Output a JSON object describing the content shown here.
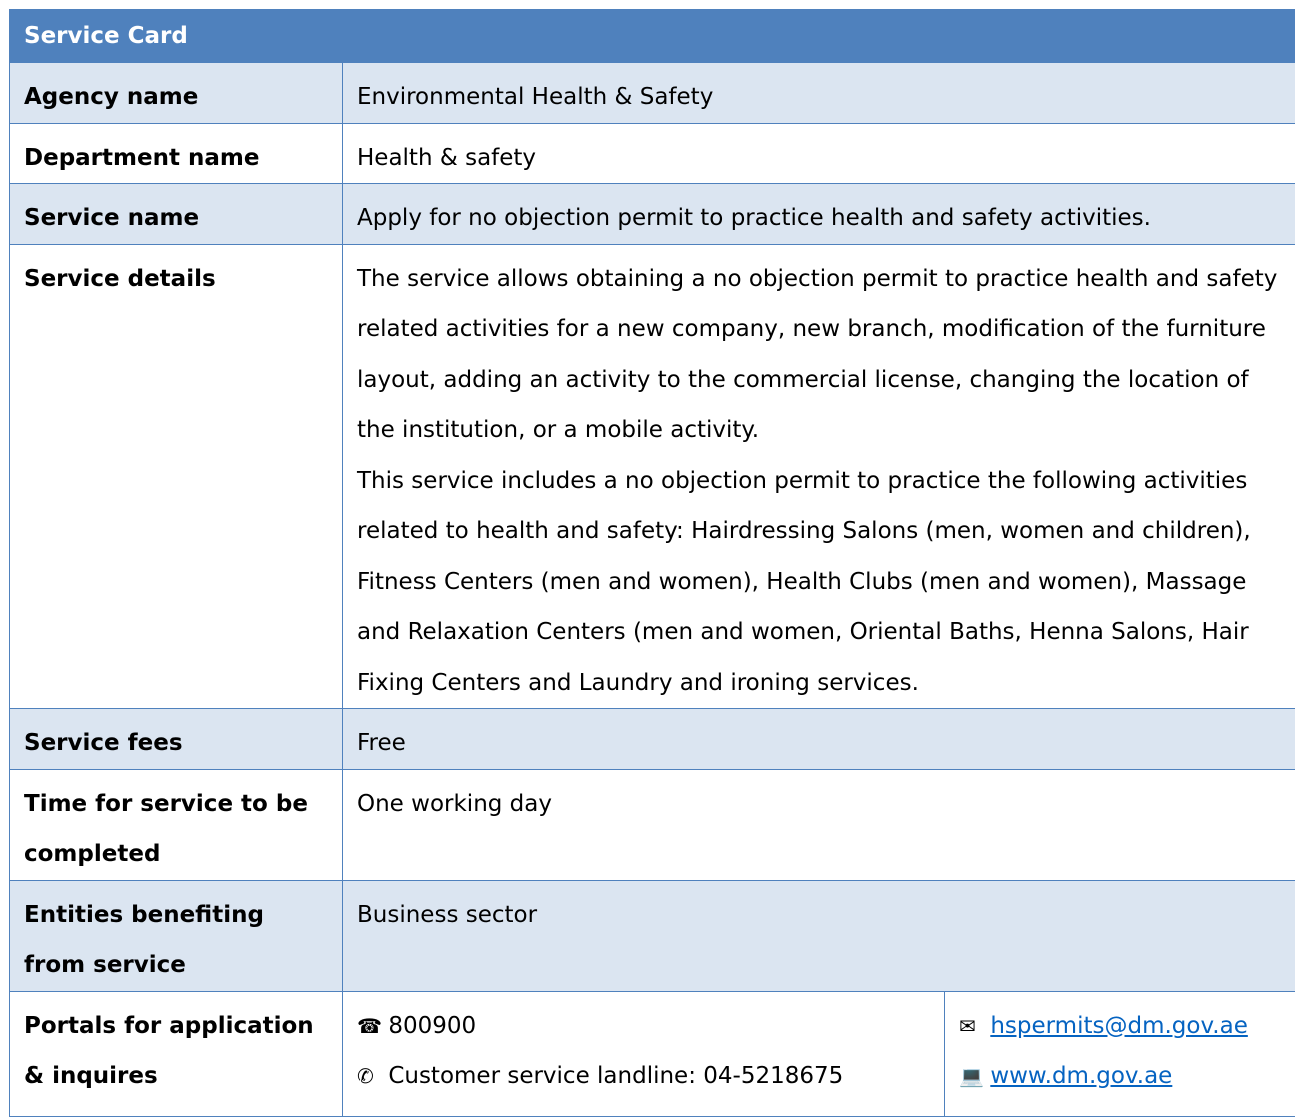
{
  "card": {
    "title": "Service Card",
    "rows": [
      {
        "label": "Agency name",
        "value": "Environmental Health & Safety"
      },
      {
        "label": "Department name",
        "value": "Health & safety"
      },
      {
        "label": "Service name",
        "value": "Apply for no objection permit to practice health and safety activities."
      },
      {
        "label": "Service details",
        "paragraph_1": "The service allows obtaining a no objection permit to practice health and safety related activities for a new company, new branch, modification of the furniture layout, adding an activity to the commercial license, changing the location of the institution, or a mobile activity.",
        "paragraph_2": "This service includes a no objection permit to practice the following activities related to health and safety: Hairdressing Salons (men, women and children), Fitness Centers (men and women), Health Clubs (men and women), Massage and Relaxation Centers (men and women, Oriental Baths, Henna Salons, Hair Fixing Centers and Laundry and ironing services."
      },
      {
        "label": "Service fees",
        "value": "Free"
      },
      {
        "label": "Time for service to be completed",
        "value": "One working day"
      },
      {
        "label": "Entities benefiting from service",
        "value": "Business sector"
      },
      {
        "label": "Portals for application & inquires",
        "phone_icon": "☎",
        "phone": "800900",
        "mobile_icon": "✆",
        "landline": "Customer service landline: 04-5218675",
        "email_icon": "✉",
        "email": "hspermits@dm.gov.ae",
        "web_icon": "💻",
        "website": "www.dm.gov.ae"
      }
    ]
  },
  "colors": {
    "header_bg": "#4f81bd",
    "shade_bg": "#dbe5f1",
    "border": "#4f81bd",
    "link": "#0563c1"
  }
}
